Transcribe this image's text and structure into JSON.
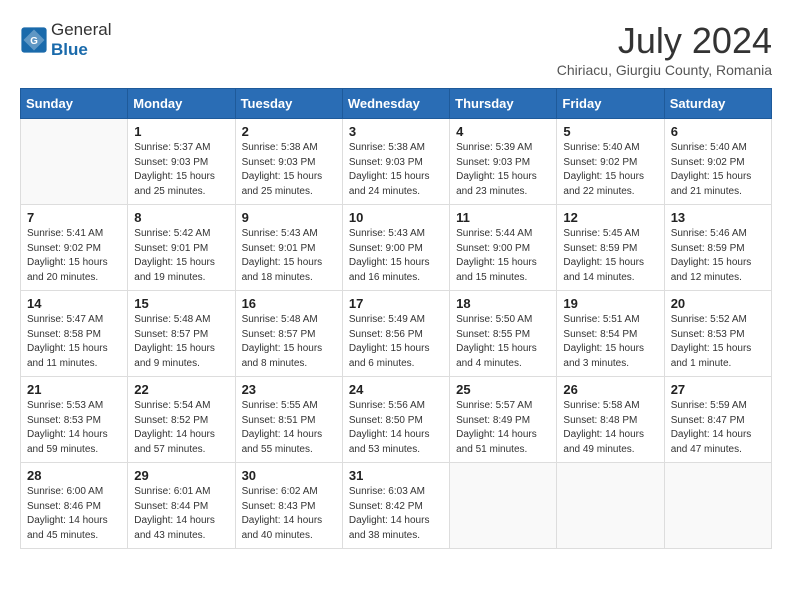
{
  "header": {
    "logo_general": "General",
    "logo_blue": "Blue",
    "month_year": "July 2024",
    "location": "Chiriacu, Giurgiu County, Romania"
  },
  "weekdays": [
    "Sunday",
    "Monday",
    "Tuesday",
    "Wednesday",
    "Thursday",
    "Friday",
    "Saturday"
  ],
  "weeks": [
    [
      {
        "day": "",
        "sunrise": "",
        "sunset": "",
        "daylight": ""
      },
      {
        "day": "1",
        "sunrise": "Sunrise: 5:37 AM",
        "sunset": "Sunset: 9:03 PM",
        "daylight": "Daylight: 15 hours and 25 minutes."
      },
      {
        "day": "2",
        "sunrise": "Sunrise: 5:38 AM",
        "sunset": "Sunset: 9:03 PM",
        "daylight": "Daylight: 15 hours and 25 minutes."
      },
      {
        "day": "3",
        "sunrise": "Sunrise: 5:38 AM",
        "sunset": "Sunset: 9:03 PM",
        "daylight": "Daylight: 15 hours and 24 minutes."
      },
      {
        "day": "4",
        "sunrise": "Sunrise: 5:39 AM",
        "sunset": "Sunset: 9:03 PM",
        "daylight": "Daylight: 15 hours and 23 minutes."
      },
      {
        "day": "5",
        "sunrise": "Sunrise: 5:40 AM",
        "sunset": "Sunset: 9:02 PM",
        "daylight": "Daylight: 15 hours and 22 minutes."
      },
      {
        "day": "6",
        "sunrise": "Sunrise: 5:40 AM",
        "sunset": "Sunset: 9:02 PM",
        "daylight": "Daylight: 15 hours and 21 minutes."
      }
    ],
    [
      {
        "day": "7",
        "sunrise": "Sunrise: 5:41 AM",
        "sunset": "Sunset: 9:02 PM",
        "daylight": "Daylight: 15 hours and 20 minutes."
      },
      {
        "day": "8",
        "sunrise": "Sunrise: 5:42 AM",
        "sunset": "Sunset: 9:01 PM",
        "daylight": "Daylight: 15 hours and 19 minutes."
      },
      {
        "day": "9",
        "sunrise": "Sunrise: 5:43 AM",
        "sunset": "Sunset: 9:01 PM",
        "daylight": "Daylight: 15 hours and 18 minutes."
      },
      {
        "day": "10",
        "sunrise": "Sunrise: 5:43 AM",
        "sunset": "Sunset: 9:00 PM",
        "daylight": "Daylight: 15 hours and 16 minutes."
      },
      {
        "day": "11",
        "sunrise": "Sunrise: 5:44 AM",
        "sunset": "Sunset: 9:00 PM",
        "daylight": "Daylight: 15 hours and 15 minutes."
      },
      {
        "day": "12",
        "sunrise": "Sunrise: 5:45 AM",
        "sunset": "Sunset: 8:59 PM",
        "daylight": "Daylight: 15 hours and 14 minutes."
      },
      {
        "day": "13",
        "sunrise": "Sunrise: 5:46 AM",
        "sunset": "Sunset: 8:59 PM",
        "daylight": "Daylight: 15 hours and 12 minutes."
      }
    ],
    [
      {
        "day": "14",
        "sunrise": "Sunrise: 5:47 AM",
        "sunset": "Sunset: 8:58 PM",
        "daylight": "Daylight: 15 hours and 11 minutes."
      },
      {
        "day": "15",
        "sunrise": "Sunrise: 5:48 AM",
        "sunset": "Sunset: 8:57 PM",
        "daylight": "Daylight: 15 hours and 9 minutes."
      },
      {
        "day": "16",
        "sunrise": "Sunrise: 5:48 AM",
        "sunset": "Sunset: 8:57 PM",
        "daylight": "Daylight: 15 hours and 8 minutes."
      },
      {
        "day": "17",
        "sunrise": "Sunrise: 5:49 AM",
        "sunset": "Sunset: 8:56 PM",
        "daylight": "Daylight: 15 hours and 6 minutes."
      },
      {
        "day": "18",
        "sunrise": "Sunrise: 5:50 AM",
        "sunset": "Sunset: 8:55 PM",
        "daylight": "Daylight: 15 hours and 4 minutes."
      },
      {
        "day": "19",
        "sunrise": "Sunrise: 5:51 AM",
        "sunset": "Sunset: 8:54 PM",
        "daylight": "Daylight: 15 hours and 3 minutes."
      },
      {
        "day": "20",
        "sunrise": "Sunrise: 5:52 AM",
        "sunset": "Sunset: 8:53 PM",
        "daylight": "Daylight: 15 hours and 1 minute."
      }
    ],
    [
      {
        "day": "21",
        "sunrise": "Sunrise: 5:53 AM",
        "sunset": "Sunset: 8:53 PM",
        "daylight": "Daylight: 14 hours and 59 minutes."
      },
      {
        "day": "22",
        "sunrise": "Sunrise: 5:54 AM",
        "sunset": "Sunset: 8:52 PM",
        "daylight": "Daylight: 14 hours and 57 minutes."
      },
      {
        "day": "23",
        "sunrise": "Sunrise: 5:55 AM",
        "sunset": "Sunset: 8:51 PM",
        "daylight": "Daylight: 14 hours and 55 minutes."
      },
      {
        "day": "24",
        "sunrise": "Sunrise: 5:56 AM",
        "sunset": "Sunset: 8:50 PM",
        "daylight": "Daylight: 14 hours and 53 minutes."
      },
      {
        "day": "25",
        "sunrise": "Sunrise: 5:57 AM",
        "sunset": "Sunset: 8:49 PM",
        "daylight": "Daylight: 14 hours and 51 minutes."
      },
      {
        "day": "26",
        "sunrise": "Sunrise: 5:58 AM",
        "sunset": "Sunset: 8:48 PM",
        "daylight": "Daylight: 14 hours and 49 minutes."
      },
      {
        "day": "27",
        "sunrise": "Sunrise: 5:59 AM",
        "sunset": "Sunset: 8:47 PM",
        "daylight": "Daylight: 14 hours and 47 minutes."
      }
    ],
    [
      {
        "day": "28",
        "sunrise": "Sunrise: 6:00 AM",
        "sunset": "Sunset: 8:46 PM",
        "daylight": "Daylight: 14 hours and 45 minutes."
      },
      {
        "day": "29",
        "sunrise": "Sunrise: 6:01 AM",
        "sunset": "Sunset: 8:44 PM",
        "daylight": "Daylight: 14 hours and 43 minutes."
      },
      {
        "day": "30",
        "sunrise": "Sunrise: 6:02 AM",
        "sunset": "Sunset: 8:43 PM",
        "daylight": "Daylight: 14 hours and 40 minutes."
      },
      {
        "day": "31",
        "sunrise": "Sunrise: 6:03 AM",
        "sunset": "Sunset: 8:42 PM",
        "daylight": "Daylight: 14 hours and 38 minutes."
      },
      {
        "day": "",
        "sunrise": "",
        "sunset": "",
        "daylight": ""
      },
      {
        "day": "",
        "sunrise": "",
        "sunset": "",
        "daylight": ""
      },
      {
        "day": "",
        "sunrise": "",
        "sunset": "",
        "daylight": ""
      }
    ]
  ]
}
